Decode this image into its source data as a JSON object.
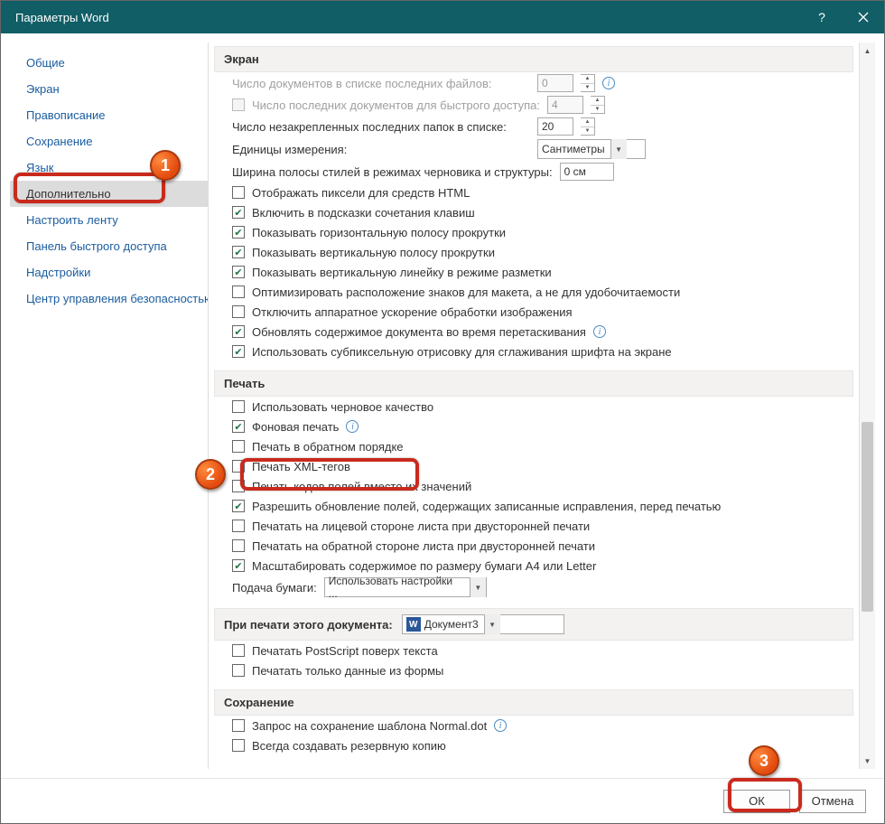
{
  "title": "Параметры Word",
  "sidebar": {
    "items": [
      {
        "label": "Общие"
      },
      {
        "label": "Экран"
      },
      {
        "label": "Правописание"
      },
      {
        "label": "Сохранение"
      },
      {
        "label": "Язык"
      },
      {
        "label": "Дополнительно",
        "selected": true
      },
      {
        "label": "Настроить ленту"
      },
      {
        "label": "Панель быстрого доступа"
      },
      {
        "label": "Надстройки"
      },
      {
        "label": "Центр управления безопасностью"
      }
    ]
  },
  "sections": {
    "screen": {
      "title": "Экран",
      "recent_docs_label": "Число документов в списке последних файлов:",
      "recent_docs_value": "0",
      "quick_access_label": "Число последних документов для быстрого доступа:",
      "quick_access_value": "4",
      "quick_access_checked": false,
      "quick_access_disabled": true,
      "recent_folders_label": "Число незакрепленных последних папок в списке:",
      "recent_folders_value": "20",
      "units_label": "Единицы измерения:",
      "units_value": "Сантиметры",
      "style_width_label": "Ширина полосы стилей в режимах черновика и структуры:",
      "style_width_value": "0 см",
      "checks": [
        {
          "label": "Отображать пиксели для средств HTML",
          "checked": false
        },
        {
          "label": "Включить в подсказки сочетания клавиш",
          "checked": true
        },
        {
          "label": "Показывать горизонтальную полосу прокрутки",
          "checked": true
        },
        {
          "label": "Показывать вертикальную полосу прокрутки",
          "checked": true
        },
        {
          "label": "Показывать вертикальную линейку в режиме разметки",
          "checked": true
        },
        {
          "label": "Оптимизировать расположение знаков для макета, а не для удобочитаемости",
          "checked": false
        },
        {
          "label": "Отключить аппаратное ускорение обработки изображения",
          "checked": false
        },
        {
          "label": "Обновлять содержимое документа во время перетаскивания",
          "checked": true,
          "info": true
        },
        {
          "label": "Использовать субпиксельную отрисовку для сглаживания шрифта на экране",
          "checked": true
        }
      ]
    },
    "print": {
      "title": "Печать",
      "checks": [
        {
          "label": "Использовать черновое качество",
          "checked": false
        },
        {
          "label": "Фоновая печать",
          "checked": true,
          "info": true
        },
        {
          "label": "Печать в обратном порядке",
          "checked": false,
          "highlighted": true
        },
        {
          "label": "Печать XML-тегов",
          "checked": false
        },
        {
          "label": "Печать кодов полей вместо их значений",
          "checked": false
        },
        {
          "label": "Разрешить обновление полей, содержащих записанные исправления, перед печатью",
          "checked": true
        },
        {
          "label": "Печатать на лицевой стороне листа при двусторонней печати",
          "checked": false
        },
        {
          "label": "Печатать на обратной стороне листа при двусторонней печати",
          "checked": false
        },
        {
          "label": "Масштабировать содержимое по размеру бумаги A4 или Letter",
          "checked": true
        }
      ],
      "paper_feed_label": "Подача бумаги:",
      "paper_feed_value": "Использовать настройки ..."
    },
    "print_doc": {
      "title": "При печати этого документа:",
      "doc_value": "Документ3",
      "checks": [
        {
          "label": "Печатать PostScript поверх текста",
          "checked": false
        },
        {
          "label": "Печатать только данные из формы",
          "checked": false
        }
      ]
    },
    "save": {
      "title": "Сохранение",
      "checks": [
        {
          "label": "Запрос на сохранение шаблона Normal.dot",
          "checked": false,
          "info": true
        },
        {
          "label": "Всегда создавать резервную копию",
          "checked": false
        }
      ]
    }
  },
  "footer": {
    "ok": "ОК",
    "cancel": "Отмена"
  },
  "annotations": {
    "n1": "1",
    "n2": "2",
    "n3": "3"
  }
}
